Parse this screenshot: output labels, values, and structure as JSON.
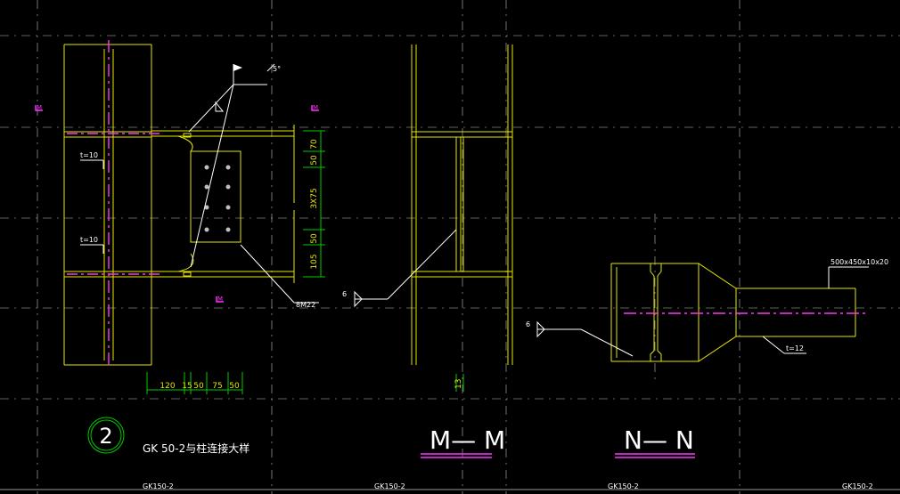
{
  "drawing": {
    "detail_number": "2",
    "detail_title": "GK 50-2与柱连接大样",
    "section_m_title": "M— M",
    "section_n_title": "N— N",
    "weld_symbol_value": "6",
    "weld_angle_label": "5°",
    "bolt_label": "8M22",
    "beam_spec_label": "500x450x10x20",
    "stiffener_left_label_top": "t=10",
    "stiffener_left_label_bottom": "t=10",
    "plate_label": "t=12",
    "section_marker": "M",
    "section_marker_mm": "13",
    "vertical_dims": [
      "70",
      "50",
      "3X75",
      "50",
      "105"
    ],
    "horizontal_dims": [
      "120",
      "15",
      "50",
      "75",
      "50"
    ],
    "bottom_labels": [
      "GK150-2",
      "GK150-2",
      "GK150-2",
      "GK150-2"
    ]
  },
  "colors": {
    "background": "#000000",
    "outline": "#e6e600",
    "dimension": "#00cc00",
    "centerline": "#ff33ff",
    "grid": "#ffffff"
  }
}
